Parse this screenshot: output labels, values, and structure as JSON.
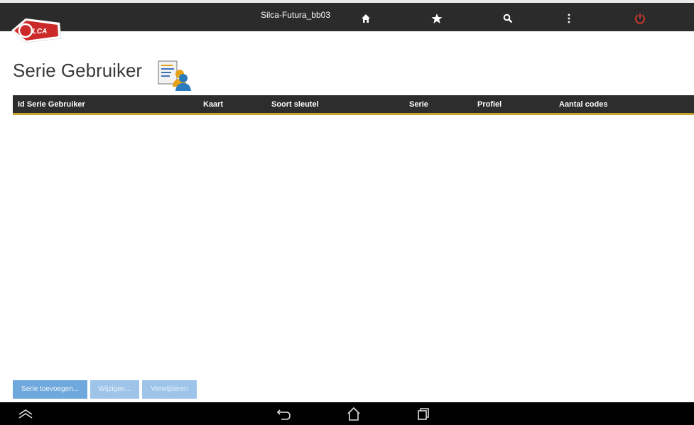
{
  "app": {
    "device_title": "Silca-Futura_bb03",
    "logo_text": "SILCA"
  },
  "toolbar": {
    "icons": [
      "home-icon",
      "star-icon",
      "search-icon",
      "more-vertical-icon",
      "power-icon"
    ],
    "power_color": "#e03a2f"
  },
  "page": {
    "title": "Serie Gebruiker",
    "title_icon": "user-document-icon"
  },
  "table": {
    "columns": [
      "Id Serie Gebruiker",
      "Kaart",
      "Soort sleutel",
      "Serie",
      "Profiel",
      "Aantal codes"
    ],
    "rows": []
  },
  "buttons": {
    "add": "Serie toevoegen...",
    "edit": "Wijzigen...",
    "delete": "Verwijderen"
  },
  "colors": {
    "accent": "#c9a22c",
    "button": "#6fa8dc",
    "bar": "#2b2b2b"
  },
  "navbar": {
    "icons": [
      "menu-chevron-icon",
      "back-icon",
      "home-outline-icon",
      "recent-apps-icon"
    ]
  }
}
